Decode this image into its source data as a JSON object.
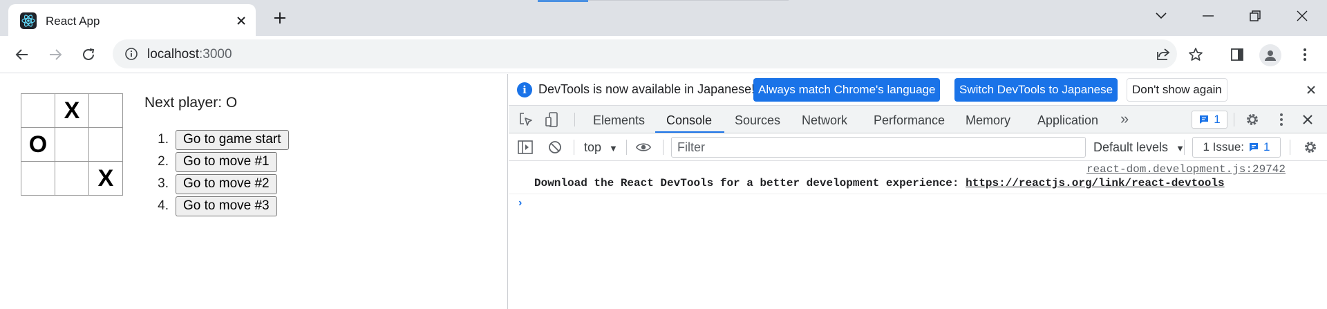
{
  "browser": {
    "tab": {
      "title": "React App"
    },
    "url": {
      "host": "localhost",
      "port": ":3000"
    }
  },
  "app": {
    "board": [
      [
        "",
        "X",
        ""
      ],
      [
        "O",
        "",
        ""
      ],
      [
        "",
        "",
        "X"
      ]
    ],
    "status": "Next player: O",
    "moves": [
      {
        "num": "1.",
        "label": "Go to game start"
      },
      {
        "num": "2.",
        "label": "Go to move #1"
      },
      {
        "num": "3.",
        "label": "Go to move #2"
      },
      {
        "num": "4.",
        "label": "Go to move #3"
      }
    ]
  },
  "devtools": {
    "infobar": {
      "message": "DevTools is now available in Japanese!",
      "btn_match": "Always match Chrome's language",
      "btn_switch": "Switch DevTools to Japanese",
      "btn_dismiss": "Don't show again"
    },
    "tabs": [
      "Elements",
      "Console",
      "Sources",
      "Network",
      "Performance",
      "Memory",
      "Application"
    ],
    "active_tab": "Console",
    "message_count": "1",
    "console": {
      "context": "top",
      "filter_placeholder": "Filter",
      "levels": "Default levels",
      "issues_label": "1 Issue:",
      "issues_count": "1",
      "log_source": "react-dom.development.js:29742",
      "log_text": "Download the React DevTools for a better development experience: ",
      "log_link": "https://reactjs.org/link/react-devtools"
    }
  },
  "colors": {
    "accent": "#1a73e8",
    "titlebar": "#dee1e6",
    "toolbar_bg": "#f1f3f4"
  }
}
